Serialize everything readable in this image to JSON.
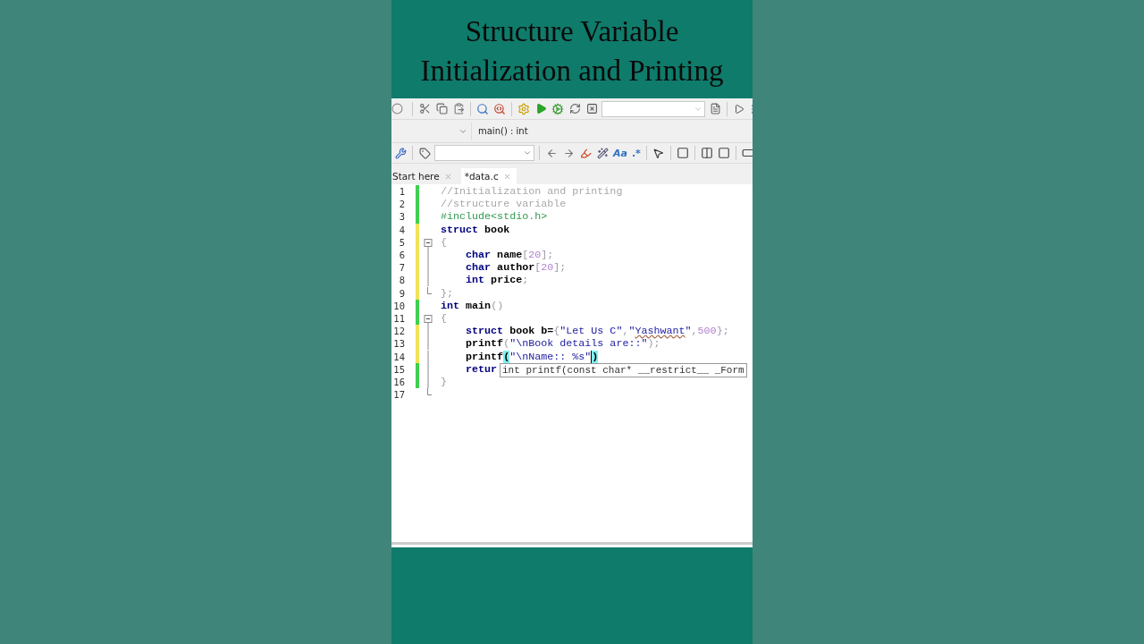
{
  "banner": {
    "title_lines": [
      "Structure Variable",
      "Initialization and Printing"
    ]
  },
  "code_toolbar": {
    "function_field": {
      "value": "main() : int"
    }
  },
  "search_toolbar": {
    "case_button": "Aa",
    "regex_button": ".*"
  },
  "tabs": [
    {
      "label": "Start here",
      "selected": false
    },
    {
      "label": "*data.c",
      "selected": true
    }
  ],
  "editor": {
    "lines": [
      {
        "number": "1",
        "color": "#3fd050",
        "kind": "plain",
        "tokens": [
          {
            "kind": "comment",
            "text": "//Initialization and printing"
          }
        ]
      },
      {
        "number": "2",
        "color": "#3fd050",
        "kind": "plain",
        "tokens": [
          {
            "kind": "comment",
            "text": "//structure variable"
          }
        ]
      },
      {
        "number": "3",
        "color": "#3fd050",
        "kind": "plain",
        "tokens": [
          {
            "kind": "preproc",
            "text": "#include<stdio.h>"
          }
        ]
      },
      {
        "number": "4",
        "color": "#f2e35a",
        "kind": "plain",
        "tokens": [
          {
            "kind": "keyword",
            "text": "struct"
          },
          {
            "kind": "ident",
            "text": " book"
          }
        ]
      },
      {
        "number": "5",
        "color": "#f2e35a",
        "kind": "start",
        "tokens": [
          {
            "kind": "punct",
            "text": "{"
          }
        ]
      },
      {
        "number": "6",
        "color": "#f2e35a",
        "kind": "body",
        "tokens": [
          {
            "kind": "keyword",
            "text": "    char"
          },
          {
            "kind": "ident",
            "text": " name"
          },
          {
            "kind": "punct",
            "text": "["
          },
          {
            "kind": "number",
            "text": "20"
          },
          {
            "kind": "punct",
            "text": "];"
          }
        ]
      },
      {
        "number": "7",
        "color": "#f2e35a",
        "kind": "body",
        "tokens": [
          {
            "kind": "keyword",
            "text": "    char"
          },
          {
            "kind": "ident",
            "text": " author"
          },
          {
            "kind": "punct",
            "text": "["
          },
          {
            "kind": "number",
            "text": "20"
          },
          {
            "kind": "punct",
            "text": "];"
          }
        ]
      },
      {
        "number": "8",
        "color": "#f2e35a",
        "kind": "body",
        "tokens": [
          {
            "kind": "keyword",
            "text": "    int"
          },
          {
            "kind": "ident",
            "text": " price"
          },
          {
            "kind": "punct",
            "text": ";"
          }
        ]
      },
      {
        "number": "9",
        "color": "#f2e35a",
        "kind": "end",
        "tokens": [
          {
            "kind": "punct",
            "text": "};"
          }
        ]
      },
      {
        "number": "10",
        "color": "#3fd050",
        "kind": "plain",
        "tokens": [
          {
            "kind": "keyword",
            "text": "int"
          },
          {
            "kind": "ident",
            "text": " main"
          },
          {
            "kind": "punct",
            "text": "()"
          }
        ]
      },
      {
        "number": "11",
        "color": "#3fd050",
        "kind": "start",
        "tokens": [
          {
            "kind": "punct",
            "text": "{"
          }
        ]
      },
      {
        "number": "12",
        "color": "#f2e35a",
        "kind": "body",
        "tokens": [
          {
            "kind": "keyword",
            "text": "    struct"
          },
          {
            "kind": "ident",
            "text": " book b="
          },
          {
            "kind": "punct",
            "text": "{"
          },
          {
            "kind": "string",
            "text": "\"Let Us C\""
          },
          {
            "kind": "punct",
            "text": ","
          },
          {
            "kind": "string",
            "text": "\""
          },
          {
            "kind": "misspelled",
            "text": "Yashwant"
          },
          {
            "kind": "string",
            "text": "\""
          },
          {
            "kind": "punct",
            "text": ","
          },
          {
            "kind": "number",
            "text": "500"
          },
          {
            "kind": "punct",
            "text": "};"
          }
        ]
      },
      {
        "number": "13",
        "color": "#f2e35a",
        "kind": "body",
        "tokens": [
          {
            "kind": "ident",
            "text": "    printf"
          },
          {
            "kind": "punct",
            "text": "("
          },
          {
            "kind": "string",
            "text": "\"\\nBook details are::\""
          },
          {
            "kind": "punct",
            "text": ");"
          }
        ]
      },
      {
        "number": "14",
        "color": "#f2e35a",
        "kind": "body",
        "tokens": [
          {
            "kind": "ident",
            "text": "    printf"
          },
          {
            "kind": "brace_match",
            "text": "("
          },
          {
            "kind": "string",
            "text": "\"\\nName:: %s\"",
            "caret": true
          },
          {
            "kind": "brace_match",
            "text": ")"
          }
        ]
      },
      {
        "number": "15",
        "color": "#3fd050",
        "kind": "body",
        "tokens": [
          {
            "kind": "keyword",
            "text": "    retur"
          }
        ]
      },
      {
        "number": "16",
        "color": "#3fd050",
        "kind": "body",
        "tokens": [
          {
            "kind": "punct",
            "text": "}"
          }
        ]
      },
      {
        "number": "17",
        "kind": "end"
      }
    ],
    "tooltip": {
      "text": "int printf(const char* __restrict__ _Form"
    }
  }
}
